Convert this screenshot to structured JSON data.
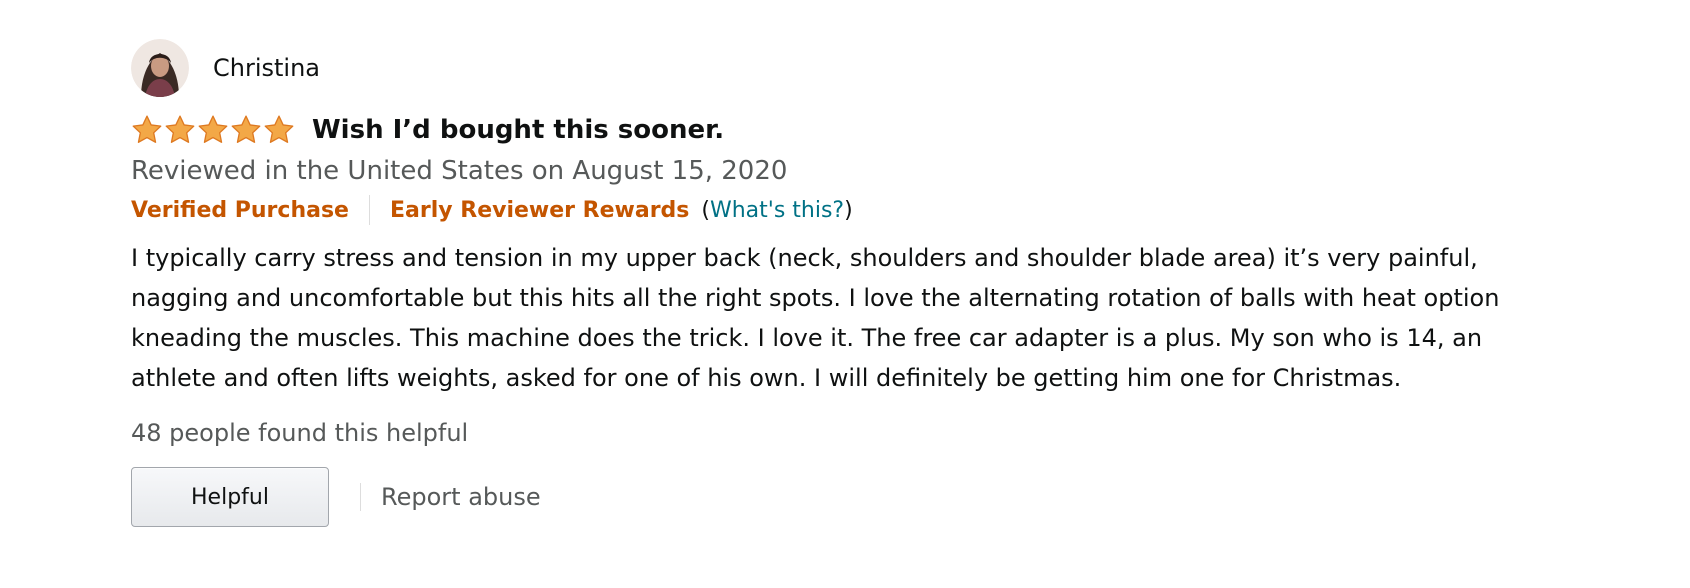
{
  "reviewer": {
    "name": "Christina",
    "avatar_icon": "profile-photo"
  },
  "rating": {
    "stars": 5,
    "max": 5,
    "star_color": "#f3a847",
    "star_stroke": "#de7921"
  },
  "review": {
    "title": "Wish I’d bought this sooner.",
    "date_line": "Reviewed in the United States on August 15, 2020",
    "badges": {
      "verified": "Verified Purchase",
      "early_reviewer": "Early Reviewer Rewards",
      "whats_this_open": "(",
      "whats_this": "What's this?",
      "whats_this_close": ")"
    },
    "body": "I typically carry stress and tension in my upper back (neck, shoulders and shoulder blade area) it’s very painful, nagging and uncomfortable but this hits all the right spots. I love the alternating rotation of balls with heat option kneading the muscles. This machine does the trick. I love it. The free car adapter is a plus. My son who is 14, an athlete and often lifts weights, asked for one of his own. I will definitely be getting him one for Christmas.",
    "helpful_count_text": "48 people found this helpful"
  },
  "actions": {
    "helpful_label": "Helpful",
    "report_label": "Report abuse"
  },
  "colors": {
    "badge_orange": "#c45500",
    "link_teal": "#007185",
    "secondary_text": "#565959"
  }
}
